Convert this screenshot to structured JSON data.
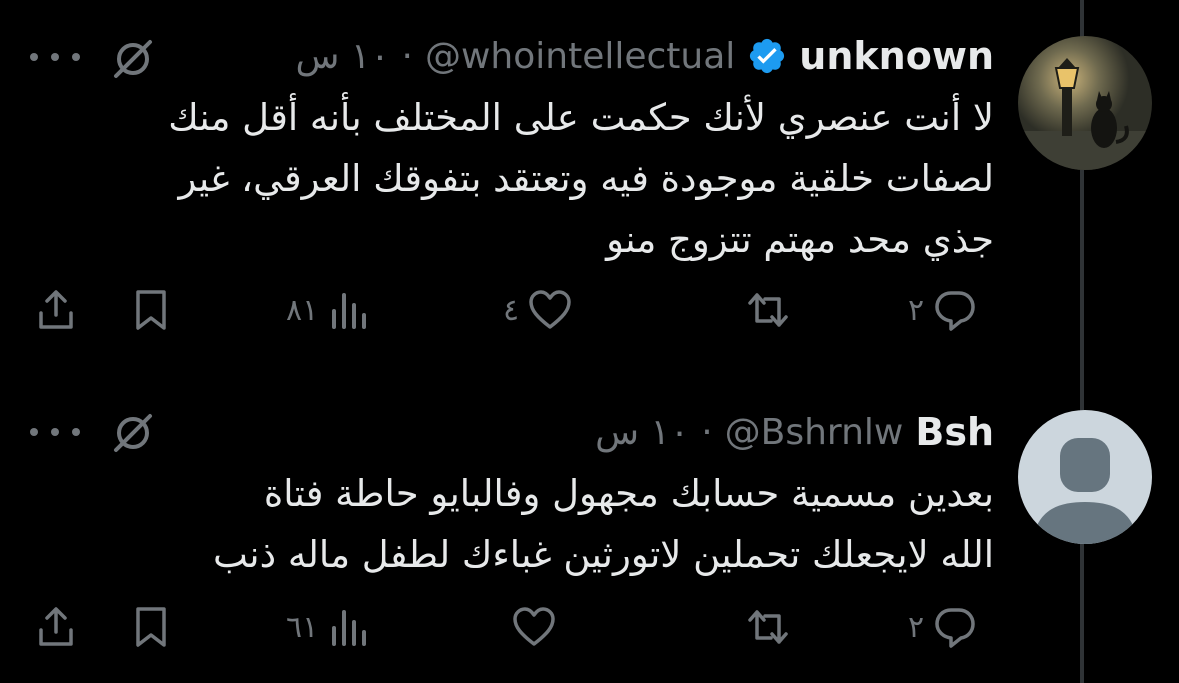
{
  "tweets": [
    {
      "display_name": "unknown",
      "verified": true,
      "handle": "@whointellectual",
      "dot": "·",
      "time": "١٠ س",
      "text": "لا أنت عنصري لأنك حكمت على المختلف بأنه أقل منك\nلصفات خلقية موجودة فيه وتعتقد بتفوقك العرقي، غير\nجذي محد مهتم تتزوج منو",
      "counts": {
        "reply": "٢",
        "repost": "",
        "like": "٤",
        "views": "٨١"
      }
    },
    {
      "display_name": "Bsh",
      "verified": false,
      "handle": "@Bshrnlw",
      "dot": "·",
      "time": "١٠ س",
      "text": "بعدين مسمية حسابك مجهول وفالبايو حاطة فتاة\nالله لايجعلك تحملين لاتورثين غباءك لطفل ماله ذنب",
      "counts": {
        "reply": "٢",
        "repost": "",
        "like": "",
        "views": "٦١"
      }
    }
  ],
  "icons": {
    "reply": "reply-icon",
    "repost": "repost-icon",
    "like": "like-icon",
    "views": "views-icon",
    "bookmark": "bookmark-icon",
    "share": "share-icon",
    "grok": "grok-icon",
    "more": "more-icon",
    "verified": "verified-icon"
  },
  "colors": {
    "background": "#000000",
    "text": "#e7e9ea",
    "muted": "#71767b",
    "verified": "#1d9bf0",
    "thread_line": "#2f3336"
  }
}
